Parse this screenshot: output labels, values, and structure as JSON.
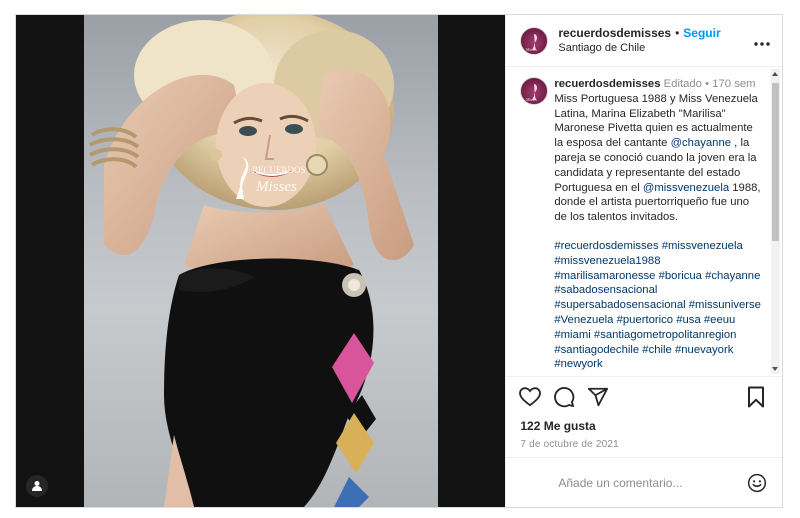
{
  "post": {
    "username": "recuerdosdemisses",
    "follow_label": "Seguir",
    "separator": "•",
    "location": "Santiago de Chile",
    "more_icon": "more-horizontal-icon",
    "caption": {
      "username": "recuerdosdemisses",
      "edited": "Editado",
      "meta_dot": "•",
      "time_ago": "170 sem",
      "text_1": "Miss Portuguesa 1988 y Miss Venezuela Latina, Marina Elizabeth \"Marilisa\" Maronese Pivetta quien es actualmente la esposa del cantante ",
      "mention_1": "@chayanne",
      "text_2": " , la pareja se conoció cuando la joven era la candidata y representante del estado Portuguesa en el ",
      "mention_2": "@missvenezuela",
      "text_3": " 1988, donde el artista puertorriqueño fue uno de los talentos invitados.",
      "hashtags": [
        "#recuerdosdemisses",
        "#missvenezuela",
        "#missvenezuela1988",
        "#marilisamaronesse",
        "#boricua",
        "#chayanne",
        "#sabadosensacional",
        "#supersabadosensacional",
        "#missuniverse",
        "#Venezuela",
        "#puertorico",
        "#usa",
        "#eeuu",
        "#miami",
        "#santiagometropolitanregion",
        "#santiagodechile",
        "#chile",
        "#nuevayork",
        "#newyork"
      ]
    },
    "likes": "122 Me gusta",
    "date": "7 de octubre de 2021",
    "comment_placeholder": "Añade un comentario...",
    "watermark_text_1": "RECUERDOS",
    "watermark_text_2": "Misses",
    "icons": {
      "like": "heart-icon",
      "comment": "comment-bubble-icon",
      "share": "paper-plane-icon",
      "save": "bookmark-icon",
      "emoji": "smiley-icon",
      "user_tag": "user-tag-icon"
    },
    "colors": {
      "follow": "#0095f6",
      "link": "#00376b",
      "muted": "#8e8e8e",
      "avatar": "#7a2150"
    }
  }
}
